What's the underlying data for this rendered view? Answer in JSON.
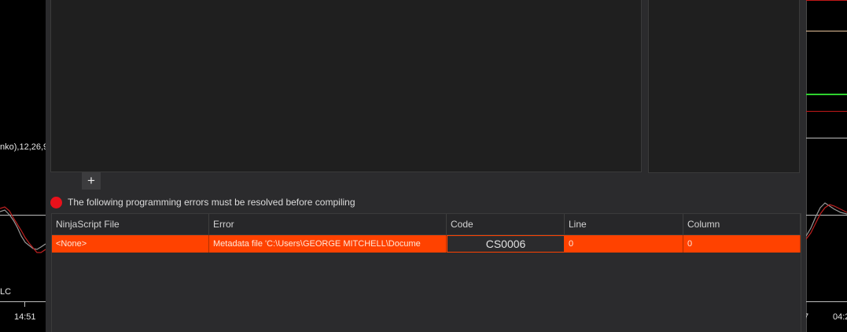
{
  "chart_left": {
    "indicator_label": "nko),12,26,9",
    "bottom_label": "LC",
    "time_label": "14:51"
  },
  "chart_right": {
    "time_label_1": "7",
    "time_label_2": "04:2"
  },
  "editor": {
    "add_button_label": "+",
    "error_message": "The following programming errors must be resolved before compiling",
    "columns": [
      "NinjaScript File",
      "Error",
      "Code",
      "Line",
      "Column"
    ],
    "rows": [
      {
        "file": "<None>",
        "error": "Metadata file 'C:\\Users\\GEORGE MITCHELL\\Docume",
        "code": "CS0006",
        "line": "0",
        "column": "0"
      }
    ]
  },
  "colors": {
    "error_row": "#ff4200",
    "error_dot": "#e8111b",
    "panel_bg": "#2b2b2d",
    "pane_bg": "#1f1f1f"
  }
}
